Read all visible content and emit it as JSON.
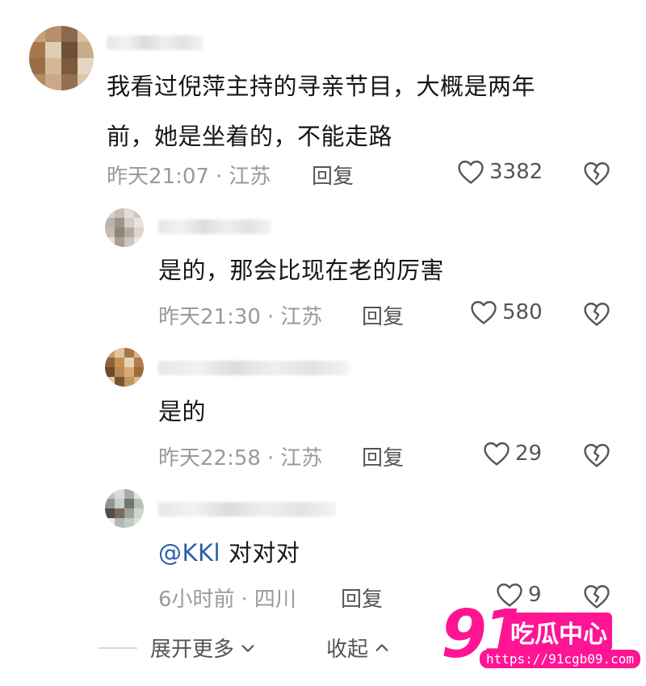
{
  "comments": [
    {
      "text_lines": [
        "我看过倪萍主持的寻亲节目，大概是两年",
        "前，她是坐着的，不能走路"
      ],
      "time": "昨天21:07",
      "location": "江苏",
      "reply_label": "回复",
      "likes": "3382"
    },
    {
      "text": "是的，那会比现在老的厉害",
      "time": "昨天21:30",
      "location": "江苏",
      "reply_label": "回复",
      "likes": "580"
    },
    {
      "text": "是的",
      "time": "昨天22:58",
      "location": "江苏",
      "reply_label": "回复",
      "likes": "29"
    },
    {
      "mention": "@KKl",
      "text": "对对对",
      "time": "6小时前",
      "location": "四川",
      "reply_label": "回复",
      "likes": "9"
    }
  ],
  "meta_separator": "·",
  "footer": {
    "expand_label": "展开更多",
    "collapse_label": "收起"
  },
  "watermark": {
    "number": "91",
    "label": "吃瓜中心",
    "url": "https://91cgb09.com"
  },
  "colors": {
    "text": "#161616",
    "meta": "#9a9a9a",
    "mention": "#2a5fa6",
    "watermark": "#ff1493"
  },
  "icons": {
    "like": "heart-outline-icon",
    "dislike": "broken-heart-icon",
    "expand": "chevron-down-icon",
    "collapse": "chevron-up-icon"
  }
}
